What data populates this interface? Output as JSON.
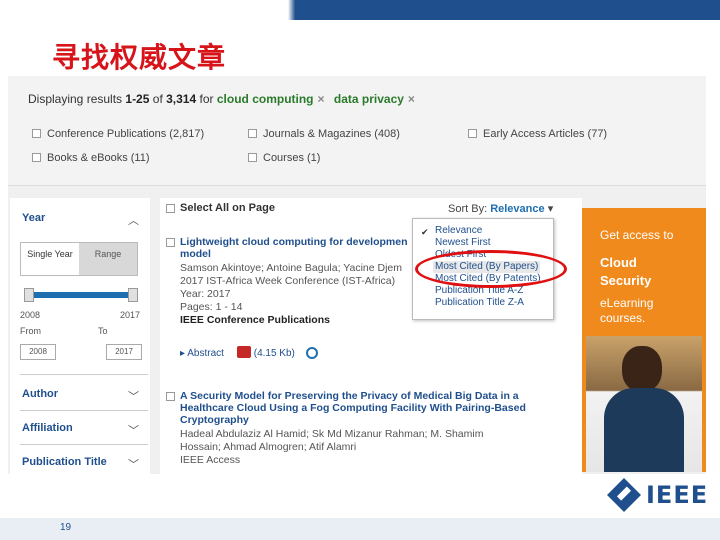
{
  "slide": {
    "title": "寻找权威文章",
    "page_number": "19"
  },
  "results_bar": {
    "prefix": "Displaying results",
    "range": "1-25",
    "of": "of",
    "total": "3,314",
    "for": "for",
    "terms": [
      "cloud computing",
      "data privacy"
    ],
    "remove_icon": "×"
  },
  "filters": [
    {
      "label": "Conference Publications (2,817)"
    },
    {
      "label": "Journals & Magazines (408)"
    },
    {
      "label": "Early Access Articles (77)"
    },
    {
      "label": "Books & eBooks (11)"
    },
    {
      "label": "Courses (1)"
    }
  ],
  "sidebar": {
    "year": {
      "heading": "Year",
      "single_label": "Single Year",
      "range_label": "Range",
      "min": "2008",
      "max": "2017",
      "from_label": "From",
      "to_label": "To",
      "from_value": "2008",
      "to_value": "2017"
    },
    "facets": [
      "Author",
      "Affiliation",
      "Publication Title"
    ]
  },
  "results": {
    "select_all": "Select All on Page",
    "sort_label": "Sort By:",
    "sort_value": "Relevance",
    "items": [
      {
        "title_lines": [
          "Lightweight cloud computing for developmen",
          "model"
        ],
        "authors": "Samson Akintoye; Antoine Bagula; Yacine Djem",
        "venue": "2017 IST-Africa Week Conference (IST-Africa)",
        "year": "Year: 2017",
        "pages": "Pages: 1 - 14",
        "publisher": "IEEE Conference Publications",
        "abstract_label": "Abstract",
        "size": "(4.15 Kb)"
      },
      {
        "title_lines": [
          "A Security Model for Preserving the Privacy of Medical Big Data in a",
          "Healthcare Cloud Using a Fog Computing Facility With Pairing-Based",
          "Cryptography"
        ],
        "authors_lines": [
          "Hadeal Abdulaziz Al Hamid; Sk Md Mizanur Rahman; M. Shamim",
          "Hossain; Ahmad Almogren; Atif Alamri"
        ],
        "publisher": "IEEE Access"
      }
    ]
  },
  "sort_dropdown": {
    "options": [
      "Relevance",
      "Newest First",
      "Oldest First",
      "Most Cited (By Papers)",
      "Most Cited (By Patents)",
      "Publication Title A-Z",
      "Publication Title Z-A"
    ],
    "selected": "Relevance",
    "highlighted": "Most Cited (By Papers)",
    "check_icon": "✔"
  },
  "ad": {
    "line1": "Get access to",
    "line2a": "Cloud",
    "line2b": "Security",
    "line3a": "eLearning",
    "line3b": "courses."
  },
  "logo": {
    "text": "IEEE"
  },
  "colors": {
    "title_red": "#d6141a",
    "ieee_blue": "#1f4f8c",
    "ad_orange": "#f08a1c",
    "annotation_red": "#e01010",
    "search_term_green": "#2b7a2b"
  }
}
